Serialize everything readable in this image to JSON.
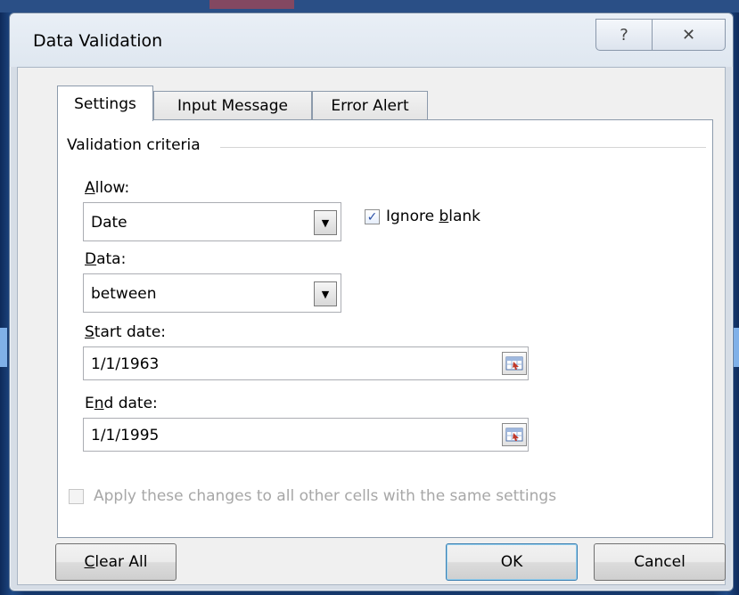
{
  "dialog": {
    "title": "Data Validation",
    "help_glyph": "?",
    "close_glyph": "✕"
  },
  "tabs": [
    {
      "label": "Settings",
      "active": true
    },
    {
      "label": "Input Message",
      "active": false
    },
    {
      "label": "Error Alert",
      "active": false
    }
  ],
  "settings": {
    "group_label": "Validation criteria",
    "allow": {
      "label_accel": "A",
      "label_rest": "llow:",
      "value": "Date"
    },
    "ignore_blank": {
      "label_pre": "Ignore ",
      "label_accel": "b",
      "label_rest": "lank",
      "checked": true
    },
    "data": {
      "label_accel": "D",
      "label_rest": "ata:",
      "value": "between"
    },
    "start_date": {
      "label_accel": "S",
      "label_rest": "tart date:",
      "value": "1/1/1963"
    },
    "end_date": {
      "label_pre": "E",
      "label_accel": "n",
      "label_rest": "d date:",
      "value": "1/1/1995"
    },
    "apply_all": {
      "label": "Apply these changes to all other cells with the same settings",
      "checked": false,
      "enabled": false
    }
  },
  "buttons": {
    "clear_all_accel": "C",
    "clear_all_rest": "lear All",
    "ok": "OK",
    "cancel": "Cancel"
  },
  "icons": {
    "dropdown": "chevron-down-icon",
    "range_picker": "range-select-icon"
  }
}
